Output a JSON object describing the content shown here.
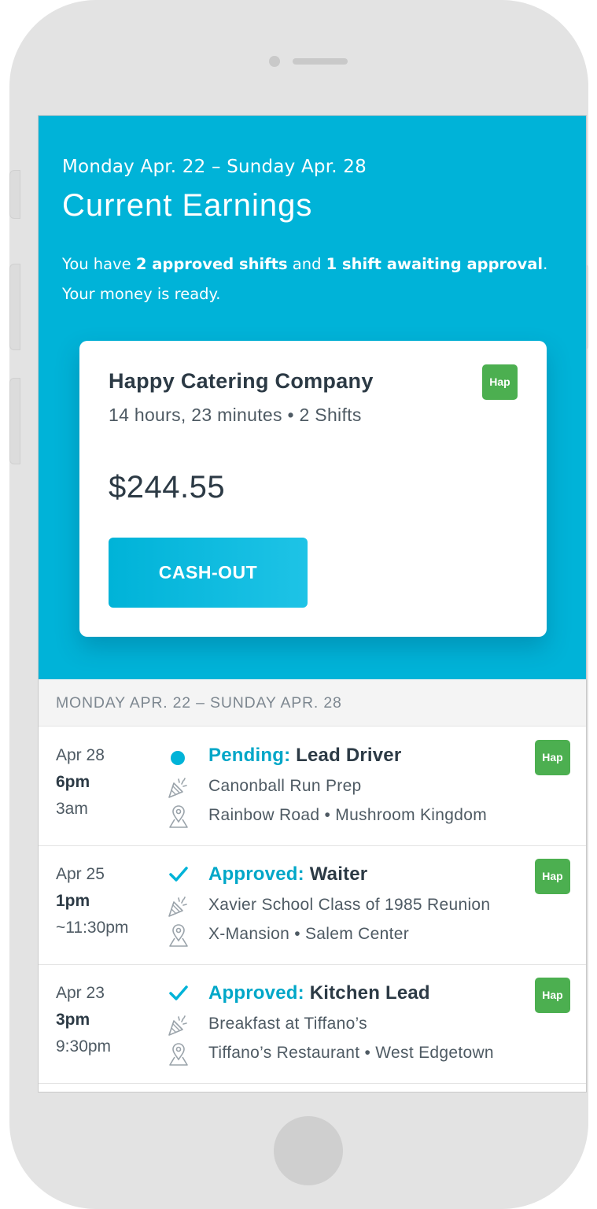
{
  "hero": {
    "range": "Monday Apr. 22 – Sunday Apr. 28",
    "title": "Current Earnings",
    "msg_pre": "You have ",
    "msg_bold1": "2 approved shifts",
    "msg_mid": " and ",
    "msg_bold2": "1 shift awaiting approval",
    "msg_post": ".",
    "msg_line2": "Your money is ready."
  },
  "card": {
    "company": "Happy Catering Company",
    "summary": "14 hours, 23 minutes • 2 Shifts",
    "amount": "$244.55",
    "cashout_label": "CASH-OUT",
    "badge": "Hap"
  },
  "section_header": "MONDAY APR. 22 – SUNDAY APR. 28",
  "shifts": [
    {
      "date": "Apr 28",
      "start": "6pm",
      "end": "3am",
      "status": "Pending:",
      "status_icon": "dot-icon",
      "role": "Lead Driver",
      "event": "Canonball Run Prep",
      "location": "Rainbow Road • Mushroom Kingdom",
      "badge": "Hap"
    },
    {
      "date": "Apr 25",
      "start": "1pm",
      "end": "~11:30pm",
      "status": "Approved:",
      "status_icon": "check-icon",
      "role": "Waiter",
      "event": "Xavier School Class of 1985 Reunion",
      "location": "X-Mansion • Salem Center",
      "badge": "Hap"
    },
    {
      "date": "Apr 23",
      "start": "3pm",
      "end": "9:30pm",
      "status": "Approved:",
      "status_icon": "check-icon",
      "role": "Kitchen Lead",
      "event": "Breakfast at Tiffano’s",
      "location": "Tiffano’s Restaurant • West Edgetown",
      "badge": "Hap"
    }
  ],
  "colors": {
    "accent": "#00b3d8",
    "badge": "#4caf50",
    "text_dark": "#2c3a45"
  }
}
